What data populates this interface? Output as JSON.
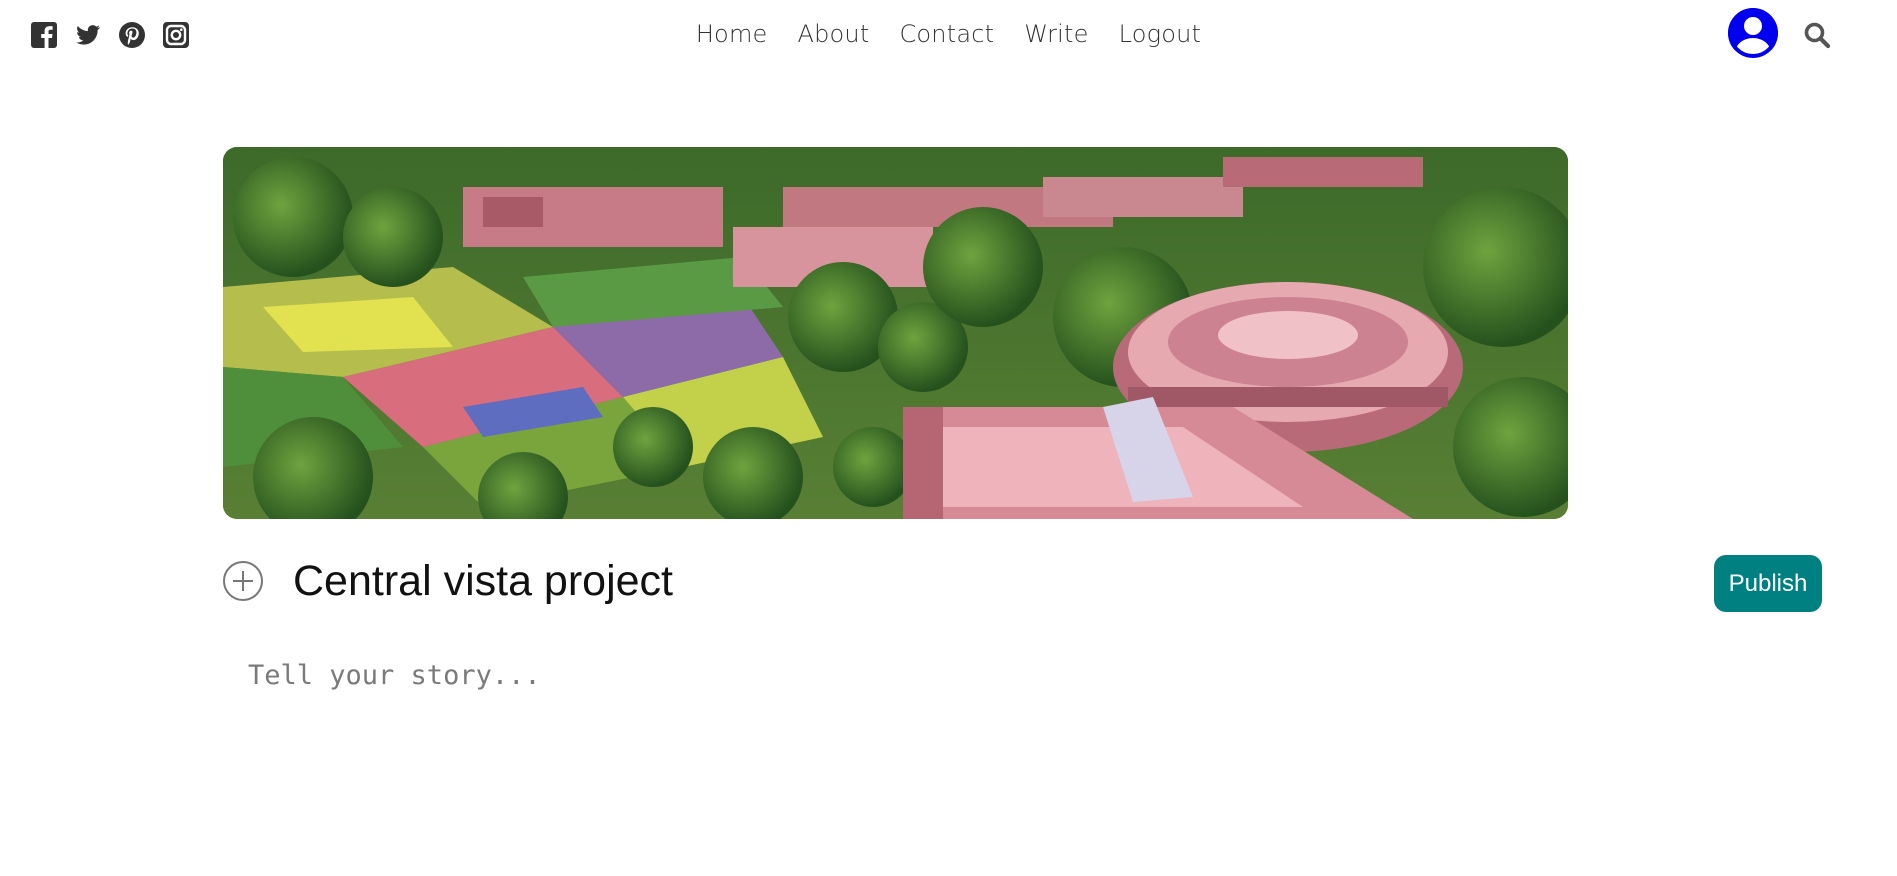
{
  "social": {
    "icons": [
      "facebook-square-icon",
      "twitter-icon",
      "pinterest-icon",
      "instagram-icon"
    ]
  },
  "nav": {
    "items": [
      {
        "label": "Home"
      },
      {
        "label": "About"
      },
      {
        "label": "Contact"
      },
      {
        "label": "Write"
      },
      {
        "label": "Logout"
      }
    ]
  },
  "header": {
    "avatar_icon": "user-circle-icon",
    "search_icon": "search-icon"
  },
  "write": {
    "cover_image_alt": "",
    "add_icon": "plus-circle-icon",
    "title_value": "Central vista project",
    "publish_label": "Publish",
    "story_placeholder": "Tell your story..."
  },
  "colors": {
    "accent": "#008080",
    "avatar": "#0000ee",
    "nav_text": "#333333"
  }
}
